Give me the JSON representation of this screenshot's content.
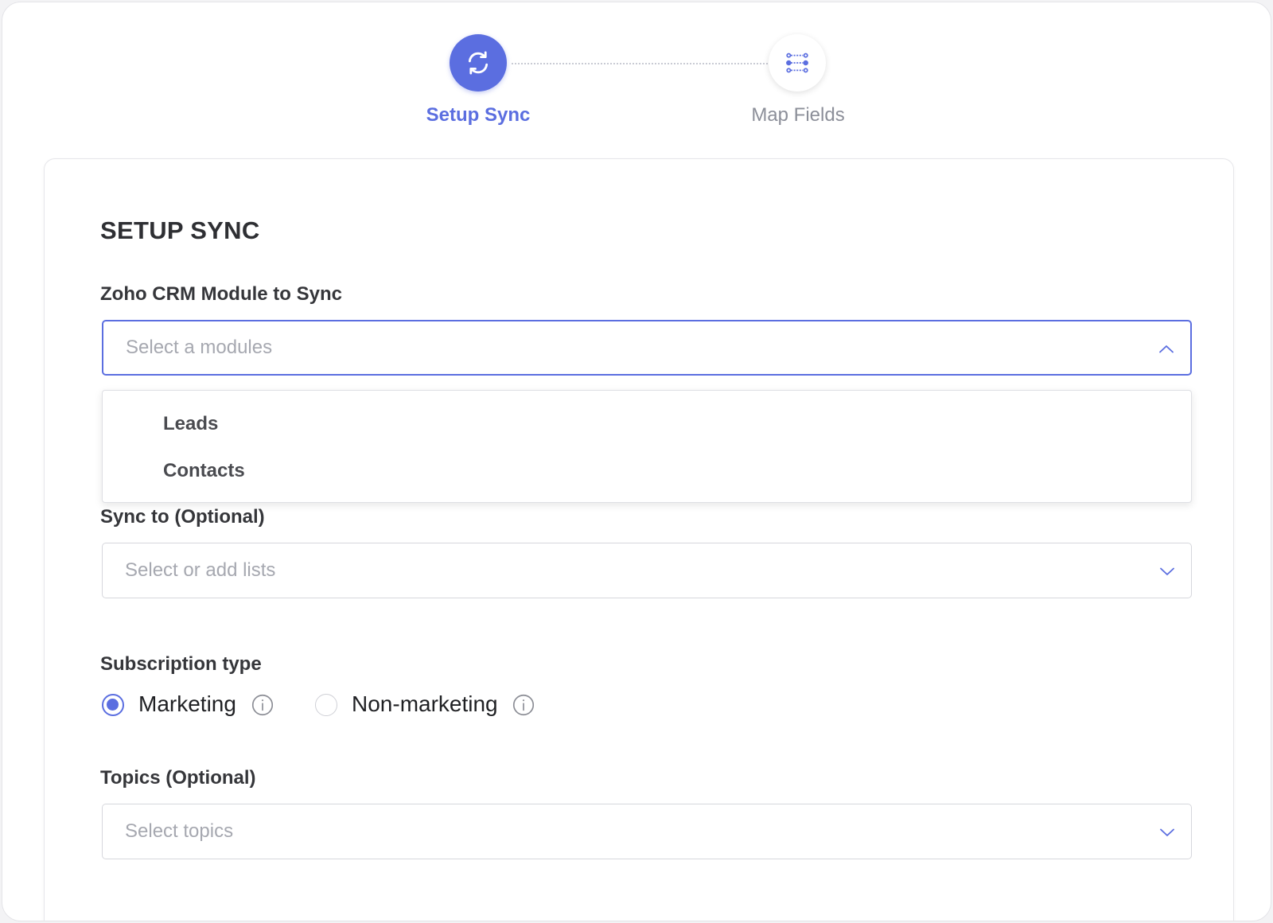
{
  "stepper": {
    "steps": [
      {
        "label": "Setup Sync",
        "icon": "sync-icon",
        "state": "active"
      },
      {
        "label": "Map Fields",
        "icon": "map-fields-icon",
        "state": "inactive"
      }
    ]
  },
  "card": {
    "title": "SETUP SYNC",
    "module": {
      "label": "Zoho CRM Module to Sync",
      "placeholder": "Select a modules",
      "open": true,
      "options": [
        "Leads",
        "Contacts"
      ]
    },
    "sync_to": {
      "label": "Sync to (Optional)",
      "placeholder": "Select or add lists"
    },
    "subscription": {
      "label": "Subscription type",
      "options": [
        {
          "label": "Marketing",
          "checked": true
        },
        {
          "label": "Non-marketing",
          "checked": false
        }
      ]
    },
    "topics": {
      "label": "Topics (Optional)",
      "placeholder": "Select topics"
    }
  },
  "colors": {
    "accent": "#5b6ee0",
    "text": "#2e2f33",
    "placeholder": "#a6a8b0",
    "inactive": "#8c8f99"
  }
}
